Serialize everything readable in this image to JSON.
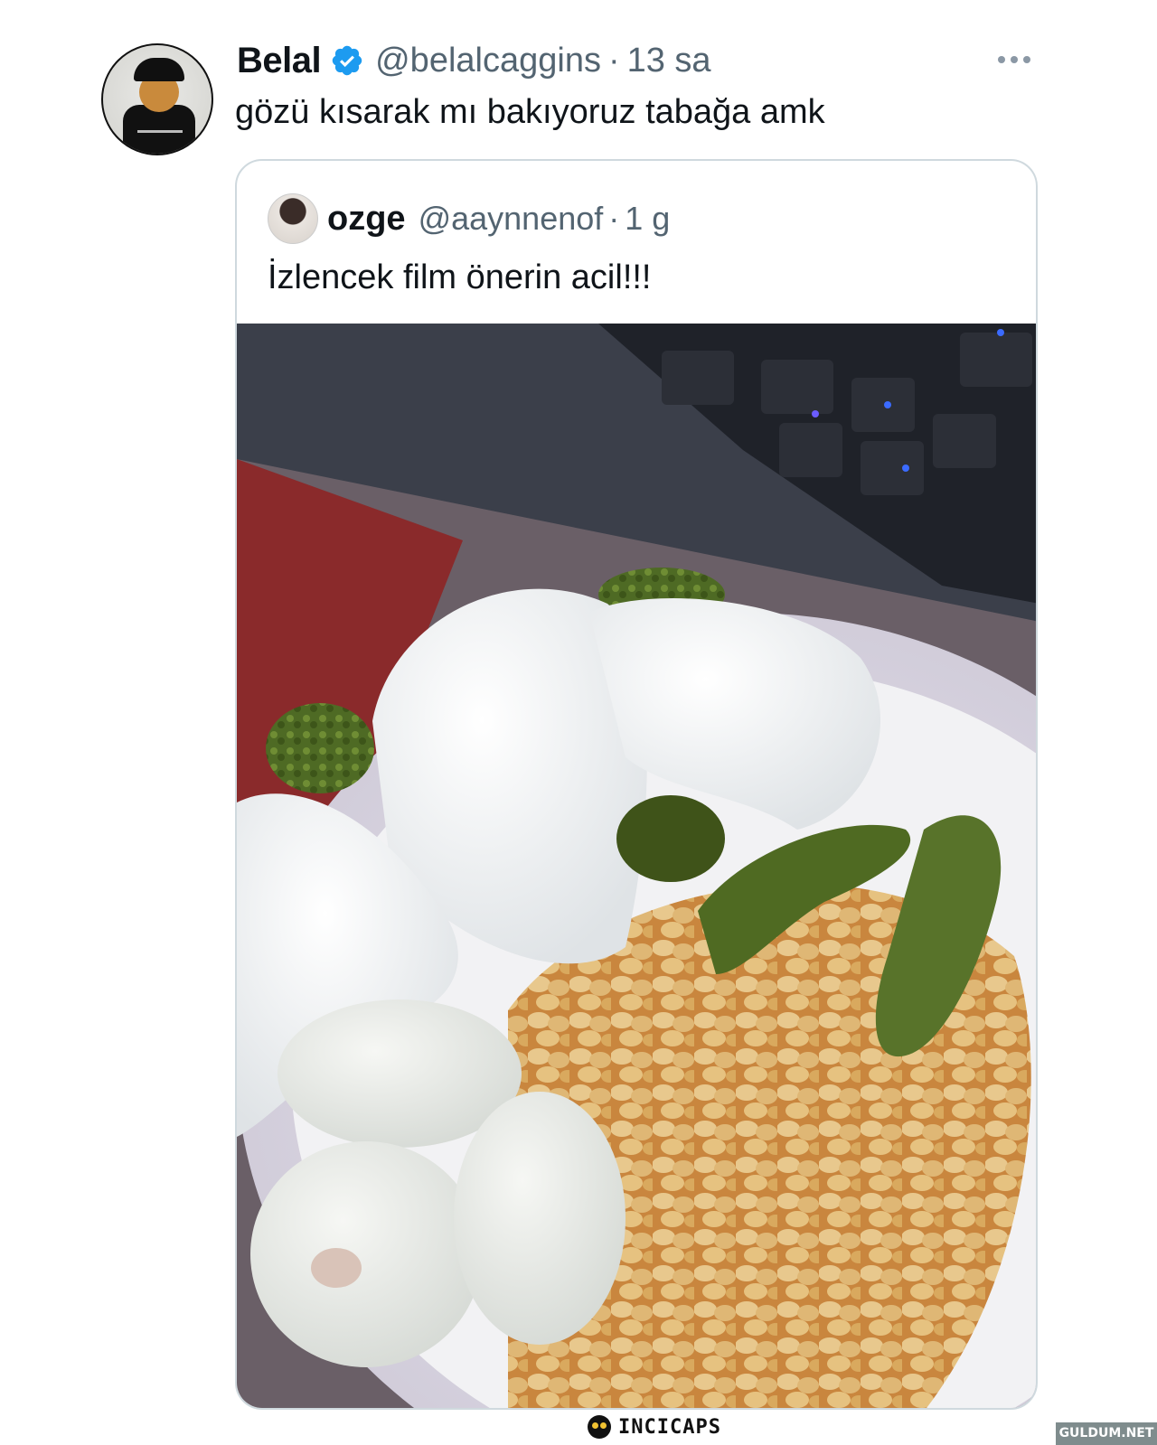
{
  "tweet": {
    "author_name": "Belal",
    "handle": "@belalcaggins",
    "separator": "·",
    "time": "13 sa",
    "text": "gözü kısarak mı bakıyoruz tabağa amk",
    "verified_icon": "verified-badge",
    "more_icon": "more-dots"
  },
  "quoted_tweet": {
    "author_name": "ozge",
    "handle": "@aaynnenof",
    "separator": "·",
    "time": "1 g",
    "text": "İzlencek film önerin acil!!!"
  },
  "watermark": {
    "brand": "INCICAPS",
    "site": "GULDUM.NET"
  },
  "colors": {
    "text": "#0f1419",
    "secondary": "#536471",
    "border": "#cfd9de",
    "verified": "#1d9bf0"
  }
}
